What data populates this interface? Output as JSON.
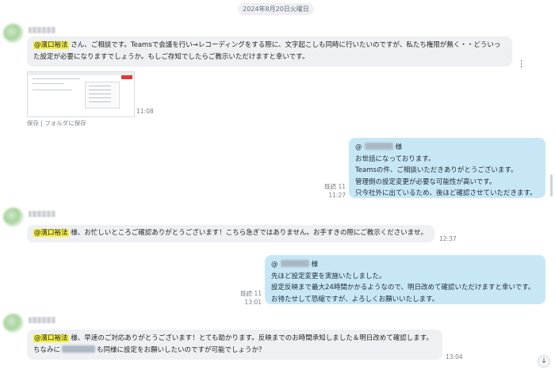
{
  "date_divider": "2024年8月20日火曜日",
  "messages": [
    {
      "mention": "@濱口裕法",
      "line1": " さん、ご相談です。Teamsで会議を行い→レコーディングをする際に、文字起こしも同時に行いたいのですが、私たち権限が無く・・どういっ",
      "line2": "た設定が必要になりますでしょうか。もしご存知でしたらご教示いただけますと幸いです。",
      "time": "11:08",
      "save": "保存",
      "sep": "|",
      "save_to_folder": "フォルダに保存"
    },
    {
      "at": "@",
      "honorific": "様",
      "lines": [
        "お世話になっております。",
        "Teamsの件、ご相談いただきありがとうございます。",
        "管理側の設定変更が必要な可能性が高いです。",
        "只今社外に出ているため、後ほど確認させていただきます。"
      ],
      "read": "既読 11",
      "time": "11:27"
    },
    {
      "mention": "@濱口裕法",
      "text": " 様、お忙しいところご確認ありがとうございます！こちら急ぎではありません。お手すきの際にご教示くださいませ。",
      "time": "12:37"
    },
    {
      "at": "@",
      "honorific": "様",
      "lines": [
        "先ほど設定変更を実施いたしました。",
        "設定反映まで最大24時間かかるようなので、明日改めて確認いただけますと幸いです。",
        "お待たせして恐縮ですが、よろしくお願いいたします。"
      ],
      "read": "既読 11",
      "time": "13:01"
    },
    {
      "mention": "@濱口裕法",
      "line1": " 様、早速のご対応ありがとうございます！とても助かります。反映までのお時間承知しました＆明日改めて確認します。",
      "line2_pre": "ちなみに",
      "line2_post": "も同様に設定をお願いしたいのですが可能でしょうか？",
      "time": "13:04"
    }
  ],
  "more_options": "⋮",
  "scroll_down": "↓",
  "colors": {
    "mention_highlight": "#f4ef47",
    "outgoing_bubble": "#c7e7f7",
    "incoming_bubble": "#eef0f3"
  }
}
